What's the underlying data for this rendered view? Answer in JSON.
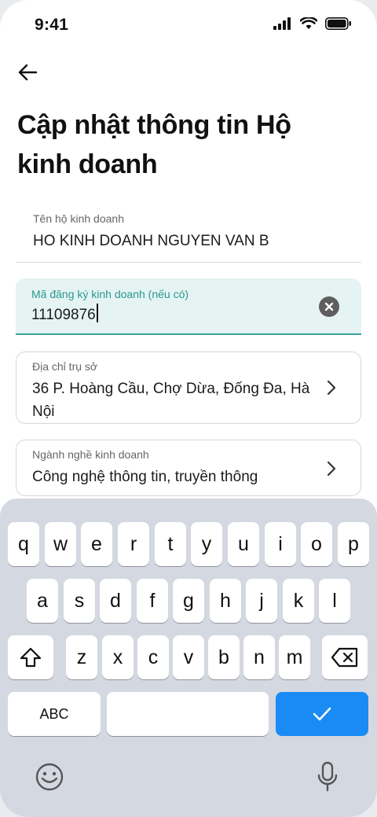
{
  "status_bar": {
    "time": "9:41"
  },
  "header": {
    "title": "Cập nhật thông tin Hộ kinh doanh"
  },
  "form": {
    "business_name": {
      "label": "Tên hộ kinh doanh",
      "value": "HO KINH DOANH NGUYEN VAN B"
    },
    "registration_code": {
      "label": "Mã đăng ký kinh doanh (nếu có)",
      "value": "11109876"
    },
    "address": {
      "label": "Địa chỉ trụ sở",
      "value": "36 P. Hoàng Cầu, Chợ Dừa, Đống Đa, Hà Nội"
    },
    "industry": {
      "label": "Ngành nghề kinh doanh",
      "value": "Công nghệ thông tin, truyền thông"
    }
  },
  "keyboard": {
    "row1": [
      "q",
      "w",
      "e",
      "r",
      "t",
      "y",
      "u",
      "i",
      "o",
      "p"
    ],
    "row2": [
      "a",
      "s",
      "d",
      "f",
      "g",
      "h",
      "j",
      "k",
      "l"
    ],
    "row3": [
      "z",
      "x",
      "c",
      "v",
      "b",
      "n",
      "m"
    ],
    "abc_label": "ABC",
    "icons": [
      "shift-icon",
      "delete-icon",
      "checkmark-icon",
      "emoji-icon",
      "microphone-icon"
    ]
  },
  "colors": {
    "accent": "#3aa29e",
    "active_field_bg": "#e5f4f3",
    "keyboard_bg": "#d4d8e1",
    "done_key": "#1a8bf5"
  }
}
